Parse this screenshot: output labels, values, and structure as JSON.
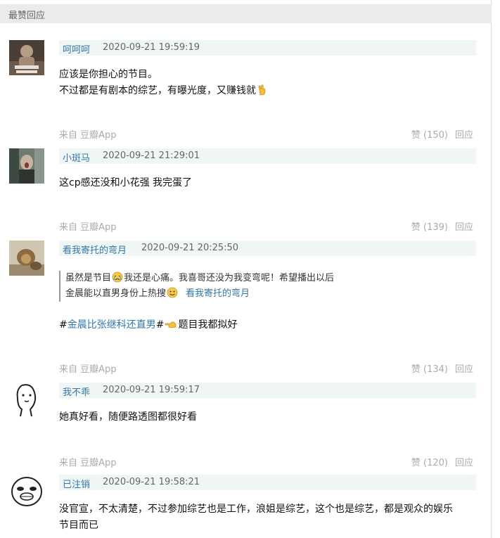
{
  "section_title": "最赞回应",
  "comments": [
    {
      "author": "呵呵呵",
      "time": "2020-09-21 19:59:19",
      "lines": [
        "应该是你担心的节目。",
        "不过都是有剧本的综艺，有曝光度，又赚钱就"
      ],
      "trailing_icon": "victory-hand-emoji",
      "source": "来自 豆瓣App",
      "likes": "赞 (150)",
      "reply": "回应"
    },
    {
      "author": "小斑马",
      "time": "2020-09-21 21:29:01",
      "lines": [
        "这cp感还没和小花强 我完蛋了"
      ],
      "source": "来自 豆瓣App",
      "likes": "赞 (139)",
      "reply": "回应"
    },
    {
      "author": "看我寄托的弯月",
      "time": "2020-09-21 20:25:50",
      "quote": {
        "line1_a": "虽然是节目",
        "line1_b": "我还是心痛。我喜哥还没为我变弯呢！希望播出以后",
        "line2_a": "金晨能以直男身份上热搜",
        "author": "看我寄托的弯月",
        "icons": [
          "crying-face-emoji",
          "smiling-face-emoji"
        ]
      },
      "hashtag_open": "#",
      "hashtag": "金晨比张继科还直男",
      "hashtag_close": "#",
      "after_hashtag": "题目我都拟好",
      "hashtag_icon": "pointing-hand-emoji",
      "source": "来自 豆瓣App",
      "likes": "赞 (134)",
      "reply": "回应"
    },
    {
      "author": "我不乖",
      "time": "2020-09-21 19:59:17",
      "lines": [
        "她真好看，随便路透图都很好看"
      ],
      "source": "来自 豆瓣App",
      "likes": "赞 (120)",
      "reply": "回应"
    },
    {
      "author": "已注销",
      "time": "2020-09-21 19:58:21",
      "lines": [
        "没官宣，不太清楚，不过参加综艺也是工作，浪姐是综艺，这个也是综艺，都是观众的娱乐",
        "节目而已"
      ]
    }
  ],
  "colors": {
    "link": "#3377aa",
    "meta_bg": "#f0f6f3",
    "header_bg": "#ebebeb",
    "muted": "#aaaaaa"
  }
}
